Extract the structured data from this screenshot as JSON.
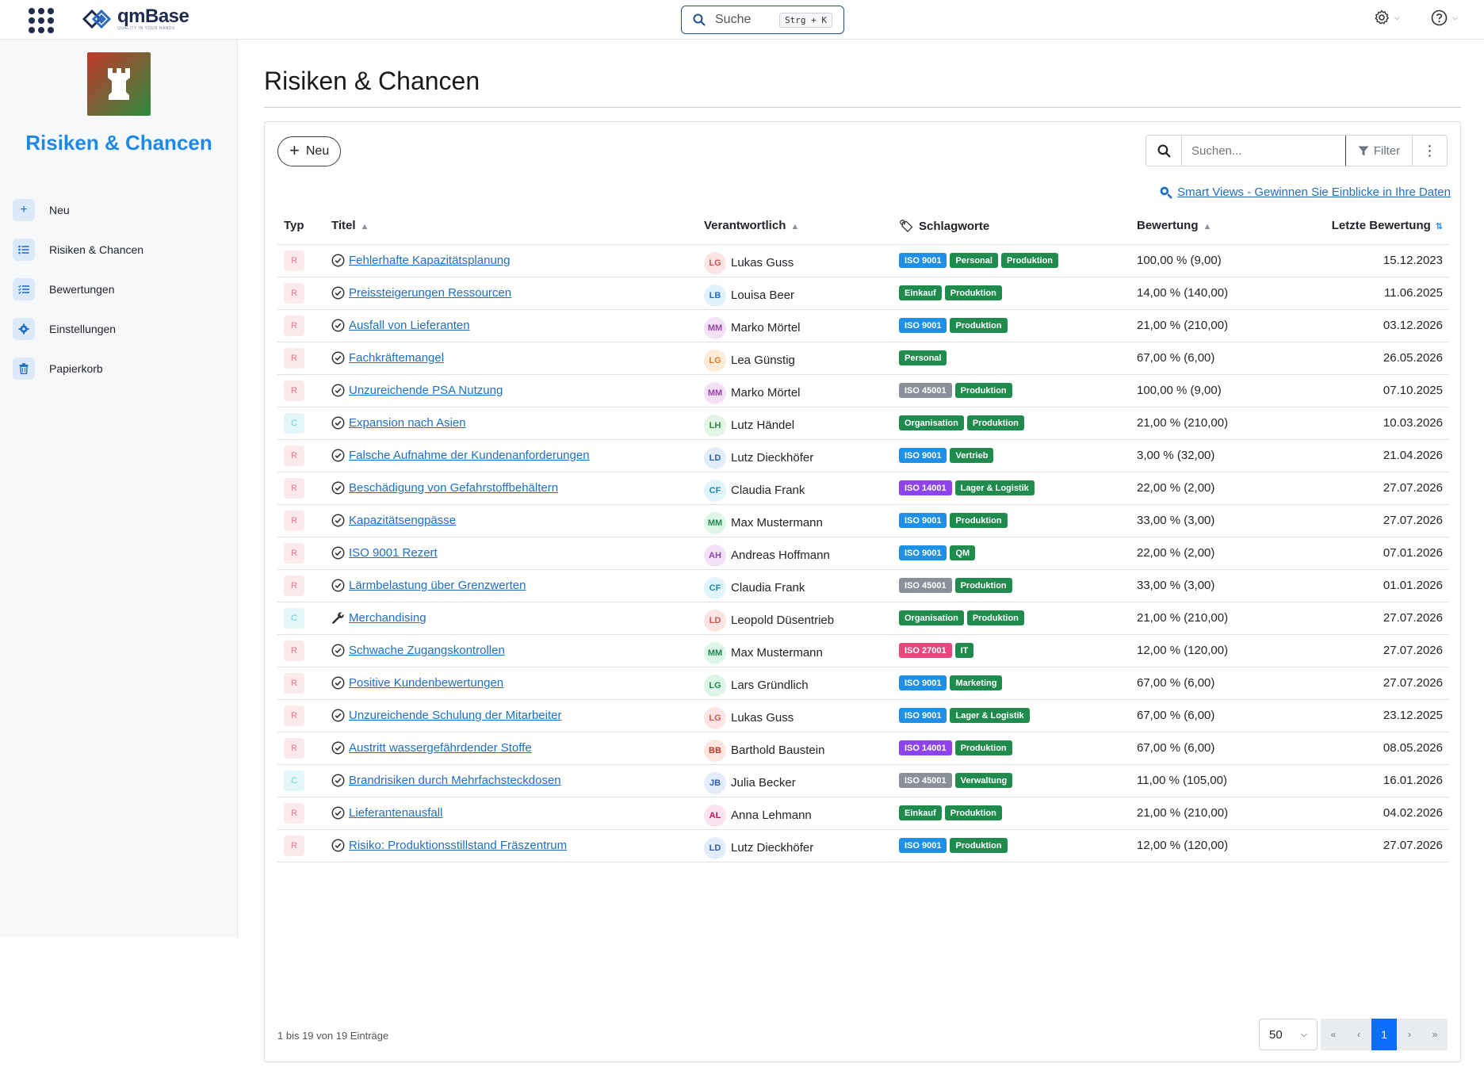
{
  "topbar": {
    "logo_name": "qmBase",
    "logo_tagline": "QUALITY IN YOUR HANDS",
    "search_label": "Suche",
    "search_shortcut": "Strg + K"
  },
  "sidebar": {
    "module_title": "Risiken & Chancen",
    "items": [
      {
        "label": "Neu",
        "icon": "plus-icon"
      },
      {
        "label": "Risiken & Chancen",
        "icon": "list-icon"
      },
      {
        "label": "Bewertungen",
        "icon": "checklist-icon"
      },
      {
        "label": "Einstellungen",
        "icon": "gear-icon"
      },
      {
        "label": "Papierkorb",
        "icon": "trash-icon"
      }
    ]
  },
  "main": {
    "title": "Risiken & Chancen",
    "new_button": "Neu",
    "search_placeholder": "Suchen...",
    "filter_label": "Filter",
    "smart_views": "Smart Views - Gewinnen Sie Einblicke in Ihre Daten",
    "columns": {
      "typ": "Typ",
      "titel": "Titel",
      "verantwortlich": "Verantwortlich",
      "schlagworte": "Schlagworte",
      "bewertung": "Bewertung",
      "letzte": "Letzte Bewertung"
    },
    "rows": [
      {
        "typ": "R",
        "status": "check",
        "title": "Fehlerhafte Kapazitätsplanung",
        "initials": "LG",
        "name": "Lukas Guss",
        "tags": [
          "ISO 9001",
          "Personal",
          "Produktion"
        ],
        "rating": "100,00 % (9,00)",
        "date": "15.12.2023"
      },
      {
        "typ": "R",
        "status": "check",
        "title": "Preissteigerungen Ressourcen",
        "initials": "LB",
        "name": "Louisa Beer",
        "tags": [
          "Einkauf",
          "Produktion"
        ],
        "rating": "14,00 % (140,00)",
        "date": "11.06.2025"
      },
      {
        "typ": "R",
        "status": "check",
        "title": "Ausfall von Lieferanten",
        "initials": "MM",
        "name": "Marko Mörtel",
        "tags": [
          "ISO 9001",
          "Produktion"
        ],
        "rating": "21,00 % (210,00)",
        "date": "03.12.2026"
      },
      {
        "typ": "R",
        "status": "check",
        "title": "Fachkräftemangel",
        "initials": "LG",
        "name": "Lea Günstig",
        "tags": [
          "Personal"
        ],
        "rating": "67,00 % (6,00)",
        "date": "26.05.2026"
      },
      {
        "typ": "R",
        "status": "check",
        "title": "Unzureichende PSA Nutzung",
        "initials": "MM",
        "name": "Marko Mörtel",
        "tags": [
          "ISO 45001",
          "Produktion"
        ],
        "rating": "100,00 % (9,00)",
        "date": "07.10.2025"
      },
      {
        "typ": "C",
        "status": "check",
        "title": "Expansion nach Asien",
        "initials": "LH",
        "name": "Lutz Händel",
        "tags": [
          "Organisation",
          "Produktion"
        ],
        "rating": "21,00 % (210,00)",
        "date": "10.03.2026"
      },
      {
        "typ": "R",
        "status": "check",
        "title": "Falsche Aufnahme der Kundenanforderungen",
        "initials": "LD",
        "name": "Lutz Dieckhöfer",
        "tags": [
          "ISO 9001",
          "Vertrieb"
        ],
        "rating": "3,00 % (32,00)",
        "date": "21.04.2026"
      },
      {
        "typ": "R",
        "status": "check",
        "title": "Beschädigung von Gefahrstoffbehältern",
        "initials": "CF",
        "name": "Claudia Frank",
        "tags": [
          "ISO 14001",
          "Lager & Logistik"
        ],
        "rating": "22,00 % (2,00)",
        "date": "27.07.2026"
      },
      {
        "typ": "R",
        "status": "check",
        "title": "Kapazitätsengpässe",
        "initials": "MM",
        "name": "Max Mustermann",
        "tags": [
          "ISO 9001",
          "Produktion"
        ],
        "rating": "33,00 % (3,00)",
        "date": "27.07.2026"
      },
      {
        "typ": "R",
        "status": "check",
        "title": "ISO 9001 Rezert",
        "initials": "AH",
        "name": "Andreas Hoffmann",
        "tags": [
          "ISO 9001",
          "QM"
        ],
        "rating": "22,00 % (2,00)",
        "date": "07.01.2026"
      },
      {
        "typ": "R",
        "status": "check",
        "title": "Lärmbelastung über Grenzwerten",
        "initials": "CF",
        "name": "Claudia Frank",
        "tags": [
          "ISO 45001",
          "Produktion"
        ],
        "rating": "33,00 % (3,00)",
        "date": "01.01.2026"
      },
      {
        "typ": "C",
        "status": "wrench",
        "title": "Merchandising",
        "initials": "LD",
        "name": "Leopold Düsentrieb",
        "tags": [
          "Organisation",
          "Produktion"
        ],
        "rating": "21,00 % (210,00)",
        "date": "27.07.2026"
      },
      {
        "typ": "R",
        "status": "check",
        "title": "Schwache Zugangskontrollen",
        "initials": "MM",
        "name": "Max Mustermann",
        "tags": [
          "ISO 27001",
          "IT"
        ],
        "rating": "12,00 % (120,00)",
        "date": "27.07.2026"
      },
      {
        "typ": "R",
        "status": "check",
        "title": "Positive Kundenbewertungen",
        "initials": "LG",
        "name": "Lars Gründlich",
        "tags": [
          "ISO 9001",
          "Marketing"
        ],
        "rating": "67,00 % (6,00)",
        "date": "27.07.2026"
      },
      {
        "typ": "R",
        "status": "check",
        "title": "Unzureichende Schulung der Mitarbeiter",
        "initials": "LG",
        "name": "Lukas Guss",
        "tags": [
          "ISO 9001",
          "Lager & Logistik"
        ],
        "rating": "67,00 % (6,00)",
        "date": "23.12.2025"
      },
      {
        "typ": "R",
        "status": "check",
        "title": "Austritt wassergefährdender Stoffe",
        "initials": "BB",
        "name": "Barthold Baustein",
        "tags": [
          "ISO 14001",
          "Produktion"
        ],
        "rating": "67,00 % (6,00)",
        "date": "08.05.2026"
      },
      {
        "typ": "C",
        "status": "check",
        "title": "Brandrisiken durch Mehrfachsteckdosen",
        "initials": "JB",
        "name": "Julia Becker",
        "tags": [
          "ISO 45001",
          "Verwaltung"
        ],
        "rating": "11,00 % (105,00)",
        "date": "16.01.2026"
      },
      {
        "typ": "R",
        "status": "check",
        "title": "Lieferantenausfall",
        "initials": "AL",
        "name": "Anna Lehmann",
        "tags": [
          "Einkauf",
          "Produktion"
        ],
        "rating": "21,00 % (210,00)",
        "date": "04.02.2026"
      },
      {
        "typ": "R",
        "status": "check",
        "title": "Risiko: Produktionsstillstand Fräszentrum",
        "initials": "LD",
        "name": "Lutz Dieckhöfer",
        "tags": [
          "ISO 9001",
          "Produktion"
        ],
        "rating": "12,00 % (120,00)",
        "date": "27.07.2026"
      }
    ],
    "footer_count": "1 bis 19 von 19 Einträge",
    "page_size": "50",
    "pagination": {
      "first": "«",
      "prev": "‹",
      "current": "1",
      "next": "›",
      "last": "»"
    }
  },
  "colors": {
    "accent": "#1e88e5",
    "link": "#1e6fc4",
    "tag_iso9001": "#1e90e6",
    "tag_green": "#1f8b4c",
    "tag_iso45001": "#8a9099",
    "tag_iso14001": "#8e44ec",
    "tag_iso27001": "#e8467c",
    "page_active": "#0d6efd"
  }
}
